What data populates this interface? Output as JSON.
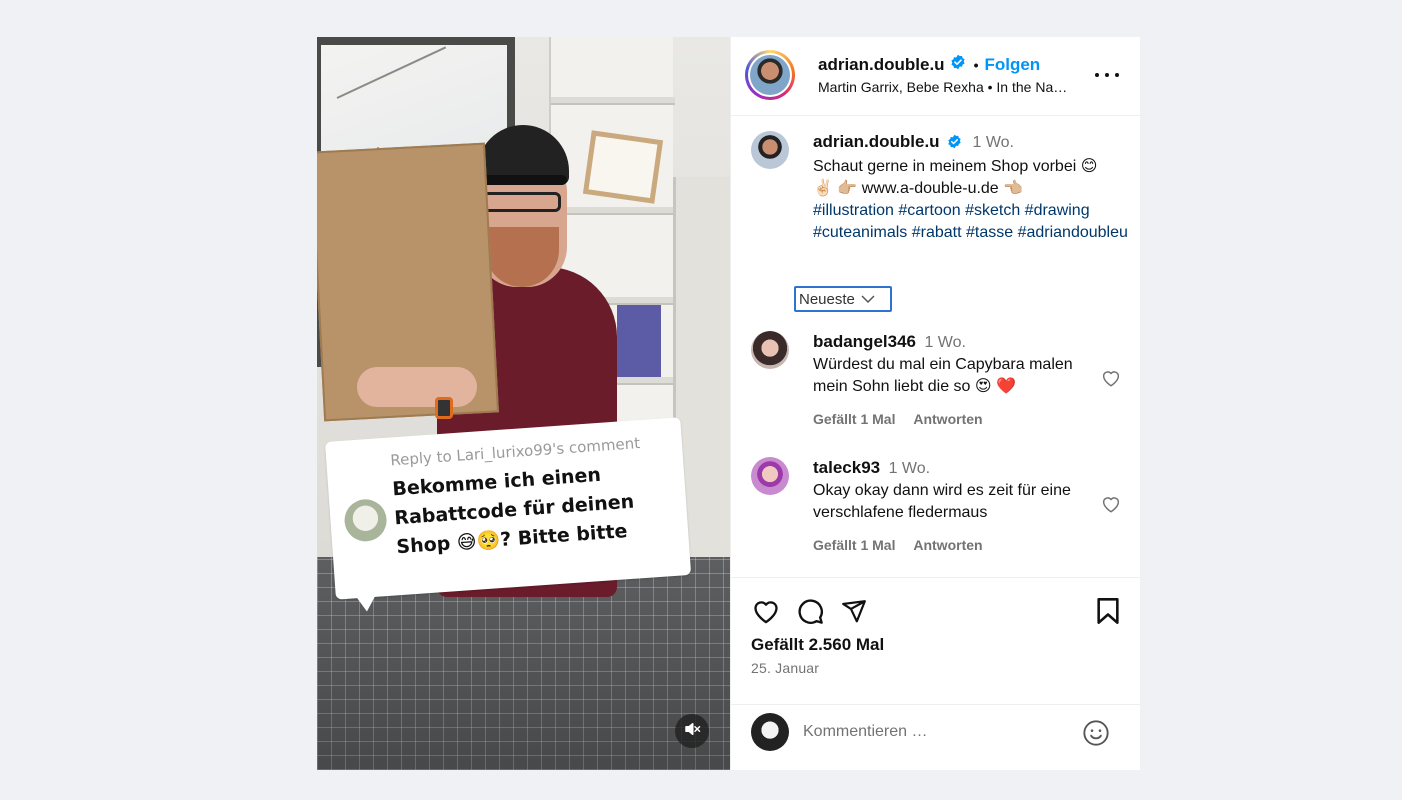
{
  "post": {
    "author": "adrian.double.u",
    "follow_label": "Folgen",
    "dot": "•",
    "subtitle": "Martin Garrix, Bebe Rexha • In the Na…",
    "caption": {
      "username": "adrian.double.u",
      "time": "1 Wo.",
      "text_line1": "Schaut gerne in meinem Shop vorbei 😊",
      "text_line2": "✌🏻 👉🏼 www.a-double-u.de 👈🏼",
      "hashtags": "#illustration #cartoon #sketch #drawing #cuteanimals #rabatt #tasse #adriandoubleu"
    },
    "sort_label": "Neueste",
    "comments": [
      {
        "username": "badangel346",
        "time": "1 Wo.",
        "text": "Würdest du mal ein Capybara malen mein Sohn liebt die so 😍 ❤️",
        "likes": "Gefällt 1 Mal",
        "reply": "Antworten"
      },
      {
        "username": "taleck93",
        "time": "1 Wo.",
        "text": "Okay okay dann wird es zeit für eine verschlafene fledermaus",
        "likes": "Gefällt 1 Mal",
        "reply": "Antworten"
      }
    ],
    "like_count": "Gefällt 2.560 Mal",
    "date": "25. Januar",
    "comment_placeholder": "Kommentieren …"
  },
  "video": {
    "reply_to": "Reply to Lari_lurixo99's comment",
    "bubble_text": "Bekomme ich einen Rabattcode für deinen Shop 😅🥺? Bitte bitte"
  },
  "colors": {
    "accent": "#0095f6",
    "hashtag": "#00376b",
    "muted": "#737373",
    "focus": "#2f73d0"
  },
  "icons": [
    "verified-badge-icon",
    "more-options-icon",
    "chevron-down-icon",
    "heart-icon",
    "comment-icon",
    "share-icon",
    "bookmark-icon",
    "emoji-icon",
    "muted-speaker-icon"
  ]
}
